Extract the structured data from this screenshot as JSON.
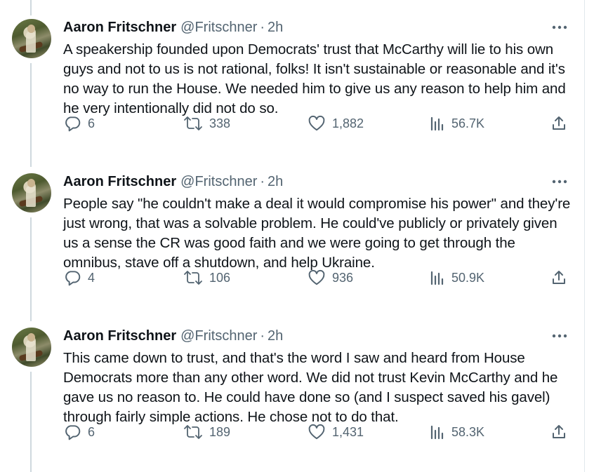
{
  "author": {
    "name": "Aaron Fritschner",
    "handle": "@Fritschner",
    "separator": "·"
  },
  "colors": {
    "text": "#0f1419",
    "muted": "#536471",
    "thread_line": "#cfd9de"
  },
  "tweets": [
    {
      "time": "2h",
      "text": "A speakership founded upon Democrats' trust that McCarthy will lie to his own guys and not to us is not rational, folks! It isn't sustainable or reasonable and it's no way to run the House. We needed him to give us any reason to help him and he very intentionally did not do so.",
      "replies": "6",
      "retweets": "338",
      "likes": "1,882",
      "views": "56.7K"
    },
    {
      "time": "2h",
      "text": "People say \"he couldn't make a deal it would compromise his power\" and they're just wrong, that was a solvable problem. He could've publicly or privately given us a sense the CR was good faith and we were going to get through the omnibus, stave off a shutdown, and help Ukraine.",
      "replies": "4",
      "retweets": "106",
      "likes": "936",
      "views": "50.9K"
    },
    {
      "time": "2h",
      "text": "This came down to trust, and that's the word I saw and heard from House Democrats more than any other word. We did not trust Kevin McCarthy and he gave us no reason to. He could have done so (and I suspect saved his gavel) through fairly simple actions. He chose not to do that.",
      "replies": "6",
      "retweets": "189",
      "likes": "1,431",
      "views": "58.3K"
    }
  ]
}
